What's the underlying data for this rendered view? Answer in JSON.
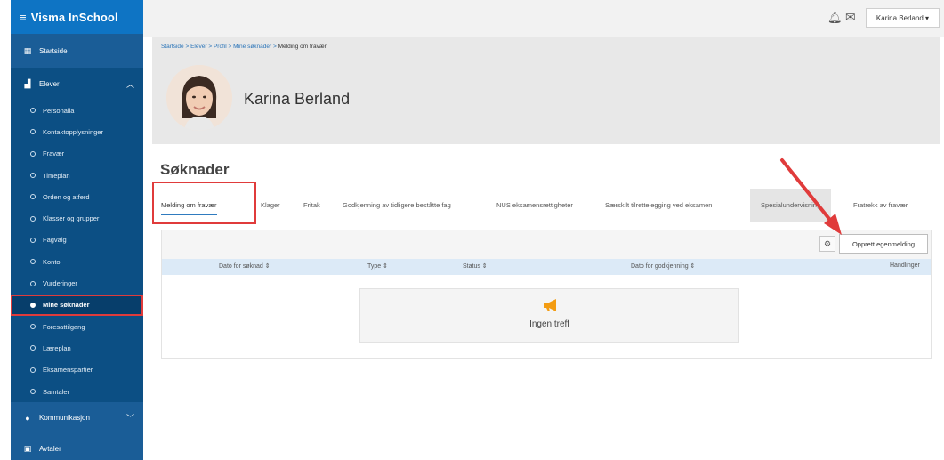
{
  "app": {
    "brand": "Visma InSchool"
  },
  "sidebar": {
    "home": "Startside",
    "group_label": "Elever",
    "items": [
      "Personalia",
      "Kontaktopplysninger",
      "Fravær",
      "Timeplan",
      "Orden og atferd",
      "Klasser og grupper",
      "Fagvalg",
      "Konto",
      "Vurderinger",
      "Mine søknader",
      "Foresattilgang",
      "Læreplan",
      "Eksamenspartier",
      "Samtaler"
    ],
    "active_item": "Mine søknader",
    "communication": "Kommunikasjon",
    "agreements": "Avtaler"
  },
  "topbar": {
    "user": "Karina Berland ▾"
  },
  "breadcrumb": {
    "items": [
      "Startside",
      "Elever",
      "Profil",
      "Mine søknader"
    ],
    "current": "Melding om fravær",
    "separator": " > "
  },
  "student": {
    "name": "Karina Berland"
  },
  "page": {
    "title": "Søknader",
    "tabs": [
      "Melding om fravær",
      "Klager",
      "Fritak",
      "Godkjenning av tidligere beståtte fag",
      "NUS eksamensrettigheter",
      "Særskilt tilrettelegging ved eksamen",
      "Spesialundervisning",
      "Fratrekk av fravær"
    ],
    "active_tab": "Melding om fravær"
  },
  "table": {
    "create_button": "Opprett egenmelding",
    "columns": [
      "Dato for søknad ⇕",
      "Type ⇕",
      "Status ⇕",
      "Dato for godkjenning ⇕",
      "Handlinger"
    ],
    "empty_text": "Ingen treff"
  },
  "colors": {
    "sidebar": "#1a5d97",
    "brand_bar": "#0e74c4",
    "highlight": "#e03b3b",
    "table_header": "#dceaf7",
    "empty_icon": "#f39c12"
  }
}
